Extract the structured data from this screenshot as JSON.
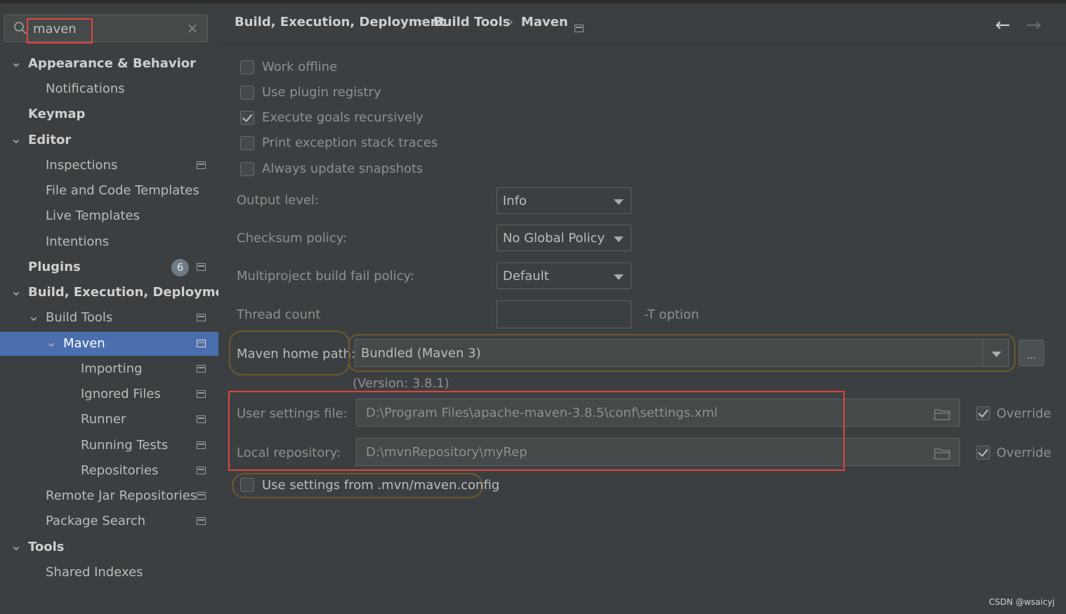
{
  "search": {
    "value": "maven",
    "clear": "×"
  },
  "sidebar": {
    "items": [
      {
        "label": "Appearance & Behavior",
        "bold": true,
        "chevron": "expanded"
      },
      {
        "label": "Notifications"
      },
      {
        "label": "Keymap",
        "bold": true
      },
      {
        "label": "Editor",
        "bold": true,
        "chevron": "expanded"
      },
      {
        "label": "Inspections",
        "icon": "page-icon"
      },
      {
        "label": "File and Code Templates"
      },
      {
        "label": "Live Templates"
      },
      {
        "label": "Intentions"
      },
      {
        "label": "Plugins",
        "bold": true,
        "badge": "6",
        "icon": "page-icon"
      },
      {
        "label": "Build, Execution, Deployment",
        "bold": true,
        "chevron": "expanded"
      },
      {
        "label": "Build Tools",
        "chevron": "expanded",
        "icon": "page-icon"
      },
      {
        "label": "Maven",
        "chevron": "expanded",
        "selected": true,
        "icon": "page-icon"
      },
      {
        "label": "Importing",
        "icon": "page-icon"
      },
      {
        "label": "Ignored Files",
        "icon": "page-icon"
      },
      {
        "label": "Runner",
        "icon": "page-icon"
      },
      {
        "label": "Running Tests",
        "icon": "page-icon"
      },
      {
        "label": "Repositories",
        "icon": "page-icon"
      },
      {
        "label": "Remote Jar Repositories",
        "icon": "page-icon"
      },
      {
        "label": "Package Search",
        "icon": "page-icon"
      },
      {
        "label": "Tools",
        "bold": true,
        "chevron": "expanded"
      },
      {
        "label": "Shared Indexes"
      }
    ]
  },
  "header": {
    "crumbs": [
      "Build, Execution, Deployment",
      "Build Tools",
      "Maven"
    ],
    "separator": "›",
    "back": "←",
    "forward": "→"
  },
  "settings": {
    "work_offline": "Work offline",
    "use_plugin_registry": "Use plugin registry",
    "execute_goals": "Execute goals recursively",
    "print_exception": "Print exception stack traces",
    "always_update": "Always update snapshots",
    "output_level_label": "Output level:",
    "output_level_value": "Info",
    "checksum_label": "Checksum policy:",
    "checksum_value": "No Global Policy",
    "multiproject_label": "Multiproject build fail policy:",
    "multiproject_value": "Default",
    "thread_count_label": "Thread count",
    "thread_count_value": "",
    "t_option": "-T option",
    "maven_home_label": "Maven home path:",
    "maven_home_value": "Bundled (Maven 3)",
    "browse": "...",
    "version": "(Version: 3.8.1)",
    "user_settings_label": "User settings file:",
    "user_settings_value": "D:\\Program Files\\apache-maven-3.8.5\\conf\\settings.xml",
    "override1": "Override",
    "local_repo_label": "Local repository:",
    "local_repo_value": "D:\\mvnRepository\\myRep",
    "override2": "Override",
    "use_mvn_config": "Use settings from .mvn/maven.config"
  },
  "watermark": "CSDN @wsaicyj",
  "colors": {
    "selection": "#4b6eaf",
    "highlight": "#e0453c",
    "focus": "#6b5a2b",
    "background": "#3c3f41"
  }
}
